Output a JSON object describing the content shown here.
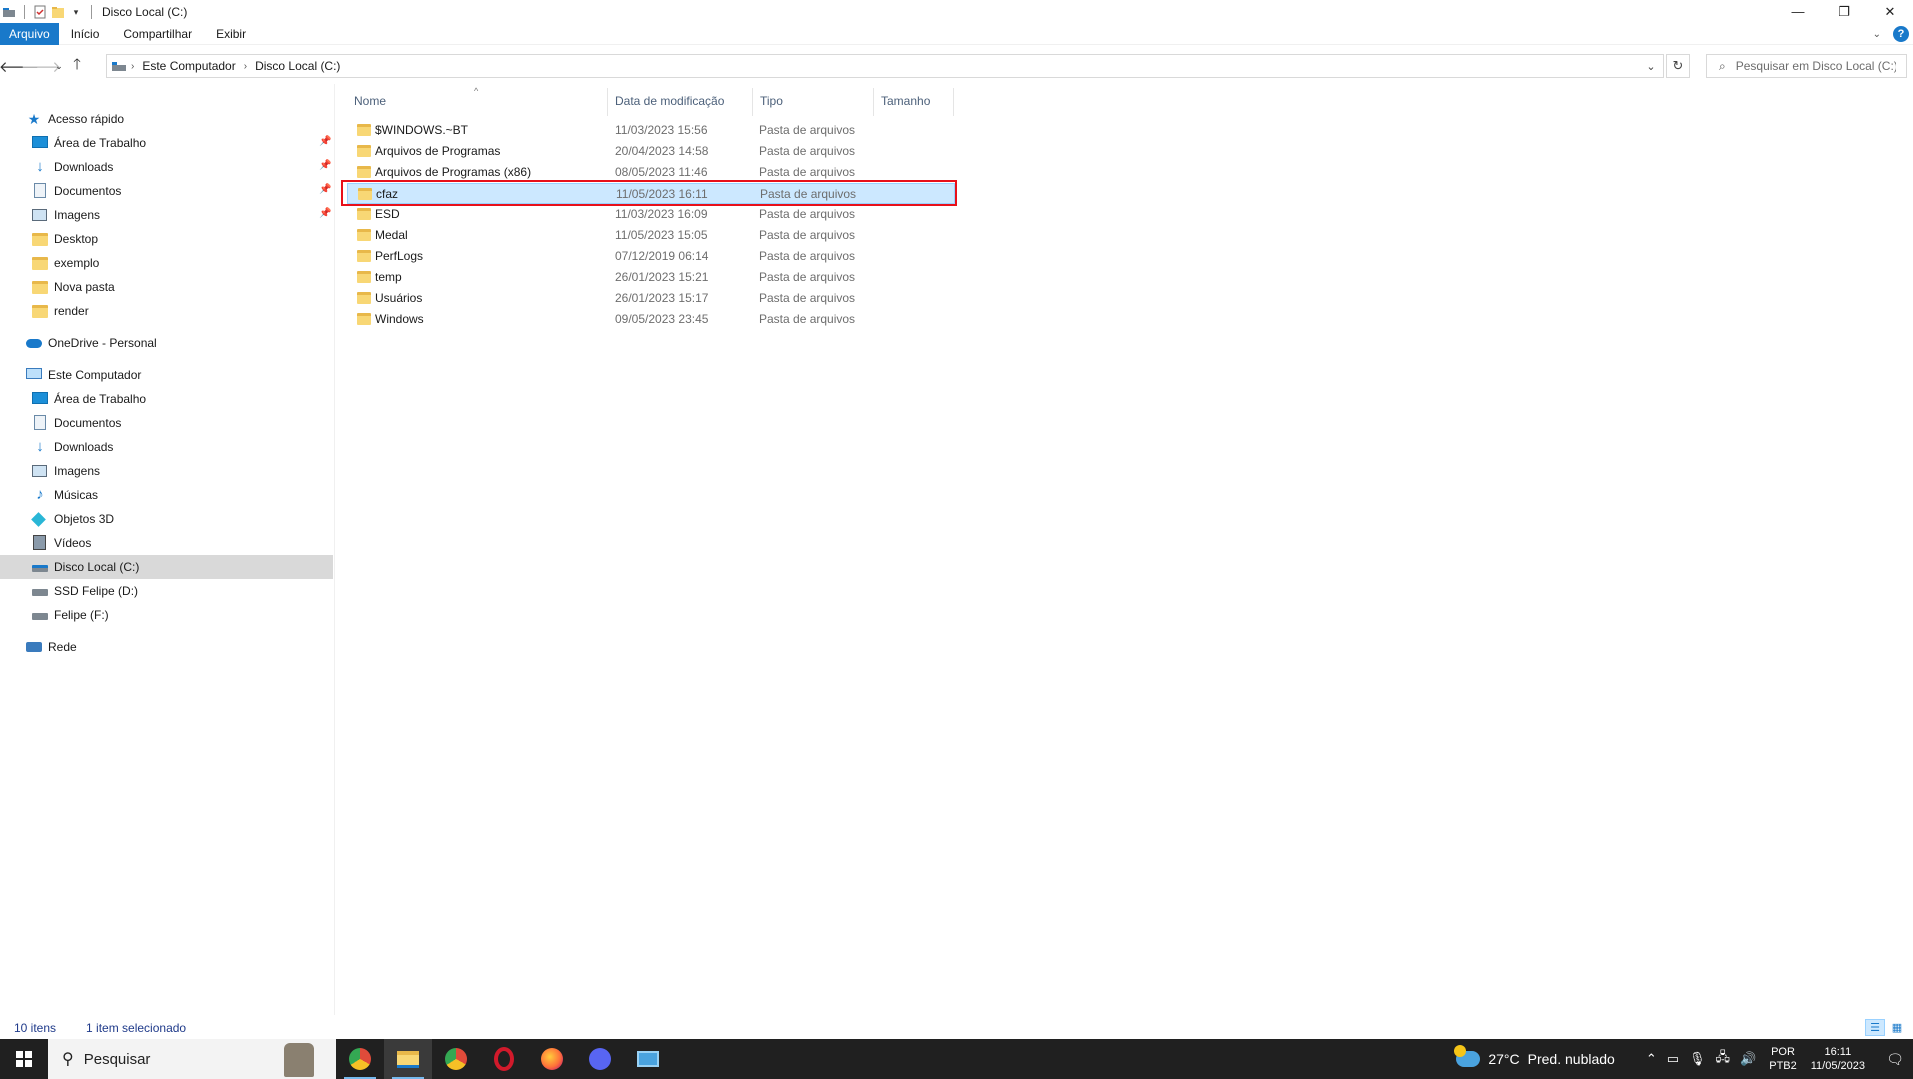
{
  "window": {
    "title": "Disco Local (C:)",
    "controls": {
      "minimize": "—",
      "maximize": "❐",
      "close": "✕"
    }
  },
  "ribbon": {
    "tabs": [
      "Arquivo",
      "Início",
      "Compartilhar",
      "Exibir"
    ],
    "help": "?"
  },
  "address": {
    "crumbs": [
      "Este Computador",
      "Disco Local (C:)"
    ],
    "separator": "›"
  },
  "search": {
    "placeholder": "Pesquisar em Disco Local (C:)"
  },
  "nav": {
    "quick_access": "Acesso rápido",
    "quick_items": [
      {
        "label": "Área de Trabalho",
        "icon": "desktop-icon",
        "pinned": true
      },
      {
        "label": "Downloads",
        "icon": "download-icon",
        "pinned": true
      },
      {
        "label": "Documentos",
        "icon": "documents-icon",
        "pinned": true
      },
      {
        "label": "Imagens",
        "icon": "pictures-icon",
        "pinned": true
      },
      {
        "label": "Desktop",
        "icon": "folder-icon",
        "pinned": false
      },
      {
        "label": "exemplo",
        "icon": "folder-icon",
        "pinned": false
      },
      {
        "label": "Nova pasta",
        "icon": "folder-icon",
        "pinned": false
      },
      {
        "label": "render",
        "icon": "folder-icon",
        "pinned": false
      }
    ],
    "onedrive": "OneDrive - Personal",
    "this_pc": "Este Computador",
    "pc_items": [
      {
        "label": "Área de Trabalho",
        "icon": "desktop-icon"
      },
      {
        "label": "Documentos",
        "icon": "documents-icon"
      },
      {
        "label": "Downloads",
        "icon": "download-icon"
      },
      {
        "label": "Imagens",
        "icon": "pictures-icon"
      },
      {
        "label": "Músicas",
        "icon": "music-icon"
      },
      {
        "label": "Objetos 3D",
        "icon": "3d-objects-icon"
      },
      {
        "label": "Vídeos",
        "icon": "videos-icon"
      },
      {
        "label": "Disco Local (C:)",
        "icon": "drive-c-icon",
        "selected": true
      },
      {
        "label": "SSD Felipe (D:)",
        "icon": "drive-icon"
      },
      {
        "label": "Felipe (F:)",
        "icon": "drive-icon"
      }
    ],
    "network": "Rede"
  },
  "columns": {
    "name": "Nome",
    "date": "Data de modificação",
    "type": "Tipo",
    "size": "Tamanho"
  },
  "files": [
    {
      "name": "$WINDOWS.~BT",
      "date": "11/03/2023 15:56",
      "type": "Pasta de arquivos"
    },
    {
      "name": "Arquivos de Programas",
      "date": "20/04/2023 14:58",
      "type": "Pasta de arquivos"
    },
    {
      "name": "Arquivos de Programas (x86)",
      "date": "08/05/2023 11:46",
      "type": "Pasta de arquivos"
    },
    {
      "name": "cfaz",
      "date": "11/05/2023 16:11",
      "type": "Pasta de arquivos",
      "selected": true
    },
    {
      "name": "ESD",
      "date": "11/03/2023 16:09",
      "type": "Pasta de arquivos"
    },
    {
      "name": "Medal",
      "date": "11/05/2023 15:05",
      "type": "Pasta de arquivos"
    },
    {
      "name": "PerfLogs",
      "date": "07/12/2019 06:14",
      "type": "Pasta de arquivos"
    },
    {
      "name": "temp",
      "date": "26/01/2023 15:21",
      "type": "Pasta de arquivos"
    },
    {
      "name": "Usuários",
      "date": "26/01/2023 15:17",
      "type": "Pasta de arquivos"
    },
    {
      "name": "Windows",
      "date": "09/05/2023 23:45",
      "type": "Pasta de arquivos"
    }
  ],
  "status": {
    "count": "10 itens",
    "selection": "1 item selecionado"
  },
  "taskbar": {
    "search_placeholder": "Pesquisar",
    "apps": [
      {
        "name": "chrome-profile-icon",
        "color": "#e04b3a",
        "running": true
      },
      {
        "name": "file-explorer-icon",
        "color": "#f8d775",
        "running": true,
        "active": true
      },
      {
        "name": "chrome-icon",
        "color": "#34a853",
        "running": false
      },
      {
        "name": "opera-icon",
        "color": "#d21a2b",
        "running": false
      },
      {
        "name": "firefox-icon",
        "color": "#ff7139",
        "running": false
      },
      {
        "name": "discord-icon",
        "color": "#5865f2",
        "running": false
      },
      {
        "name": "app-window-icon",
        "color": "#4aa3df",
        "running": false
      }
    ],
    "weather": {
      "temp": "27°C",
      "desc": "Pred. nublado"
    },
    "lang": {
      "line1": "POR",
      "line2": "PTB2"
    },
    "clock": {
      "time": "16:11",
      "date": "11/05/2023"
    }
  },
  "colors": {
    "accent": "#1979ca",
    "selection": "#cce8ff",
    "highlight": "#e8101a"
  }
}
